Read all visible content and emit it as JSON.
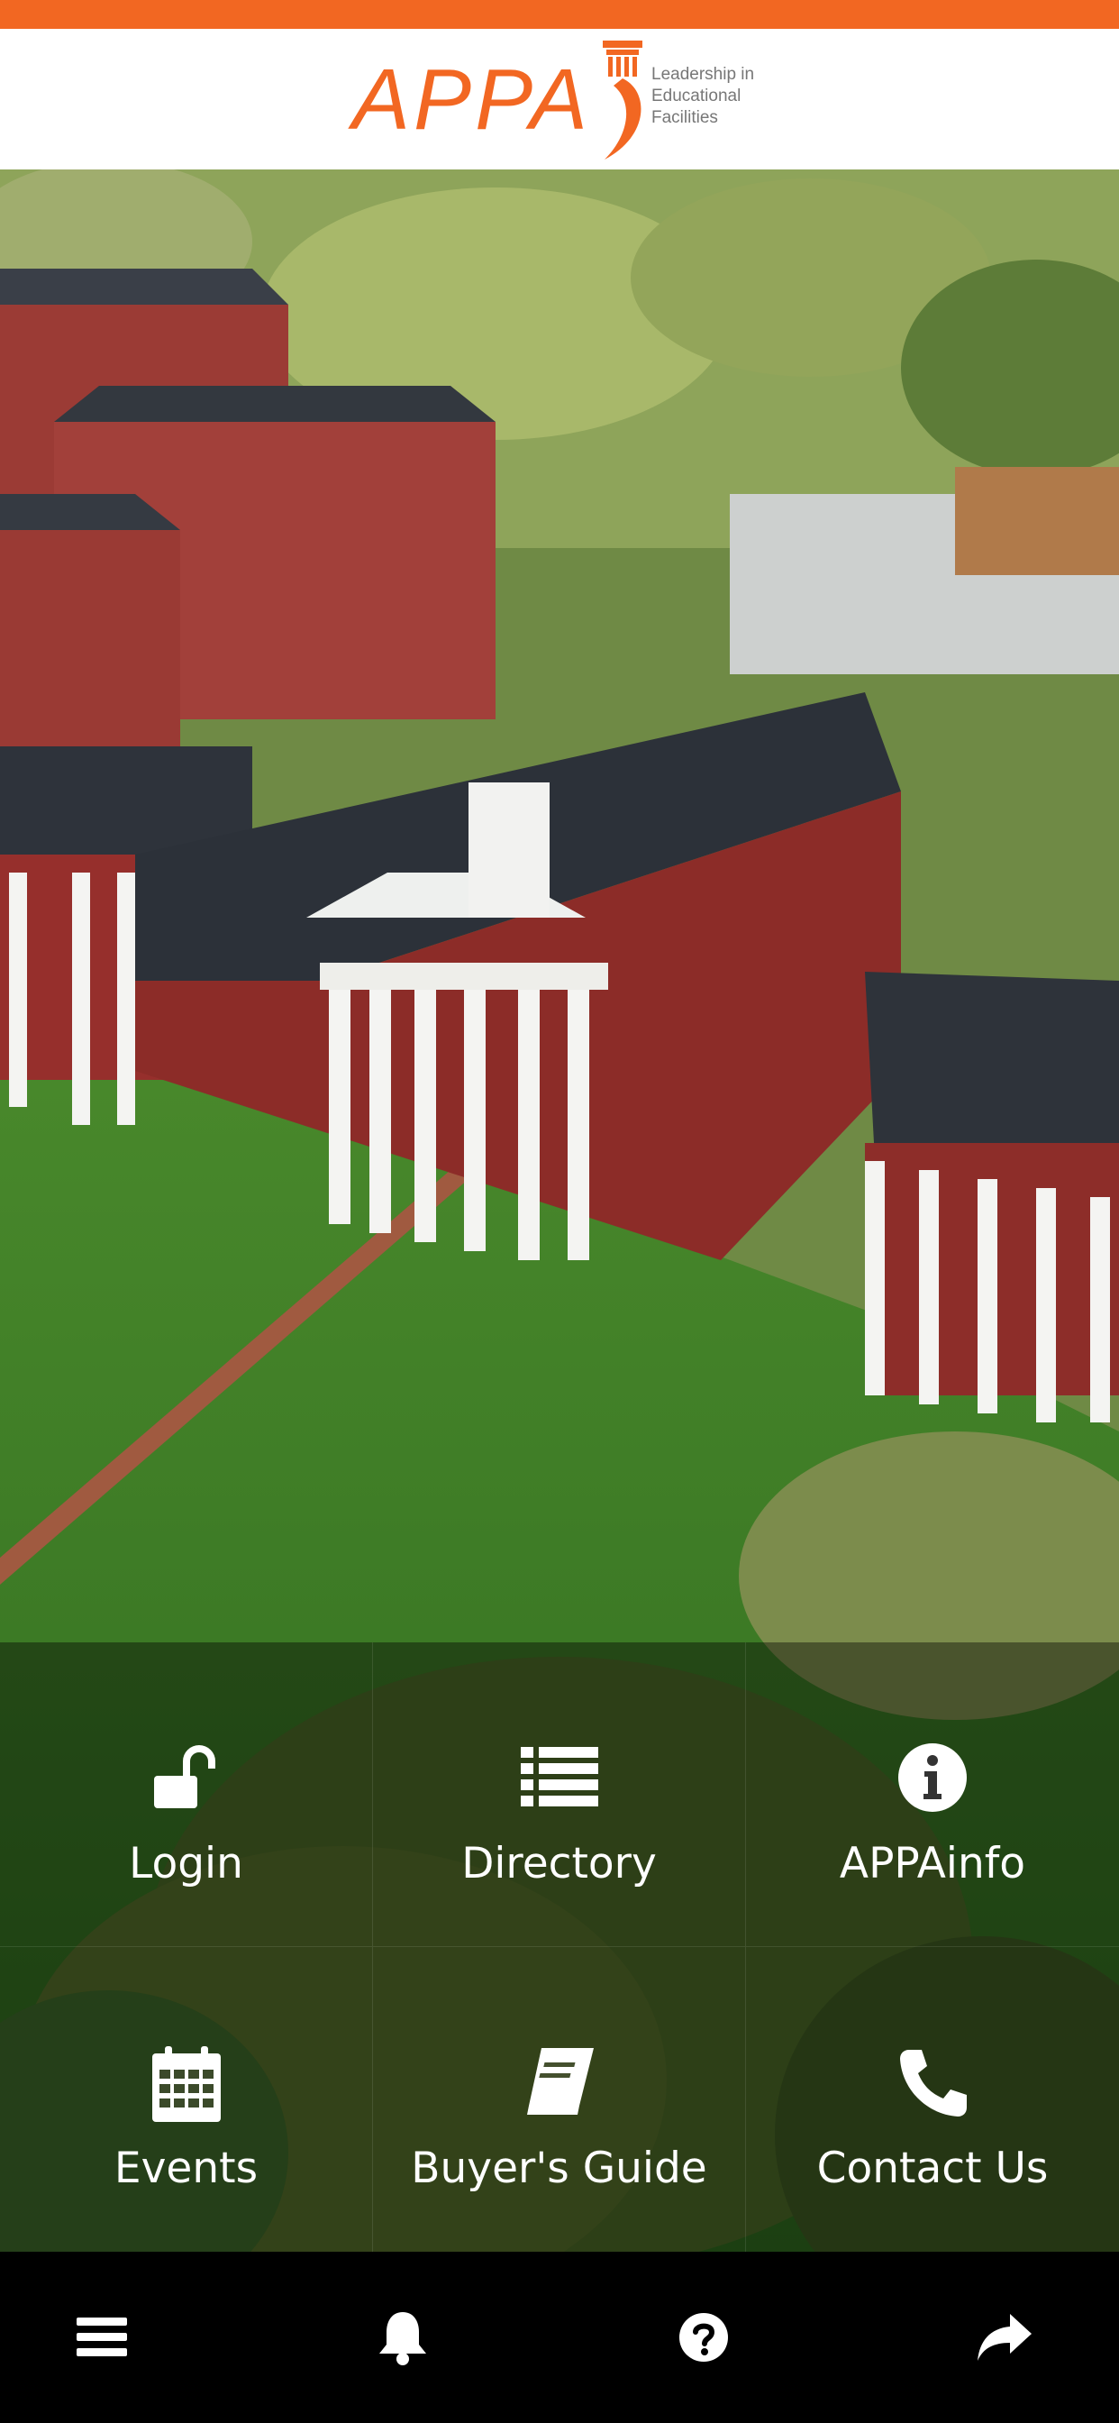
{
  "app": {
    "brand": "APPA",
    "tagline": "Leadership in\nEducational\nFacilities",
    "accent_color": "#f26722"
  },
  "tiles": [
    {
      "label": "Login",
      "icon": "unlock-icon"
    },
    {
      "label": "Directory",
      "icon": "list-icon"
    },
    {
      "label": "APPAinfo",
      "icon": "info-icon"
    },
    {
      "label": "Events",
      "icon": "calendar-icon"
    },
    {
      "label": "Buyer's Guide",
      "icon": "book-icon"
    },
    {
      "label": "Contact Us",
      "icon": "phone-icon"
    }
  ],
  "tabbar": [
    {
      "icon": "menu-icon"
    },
    {
      "icon": "bell-icon"
    },
    {
      "icon": "help-icon"
    },
    {
      "icon": "share-icon"
    }
  ]
}
